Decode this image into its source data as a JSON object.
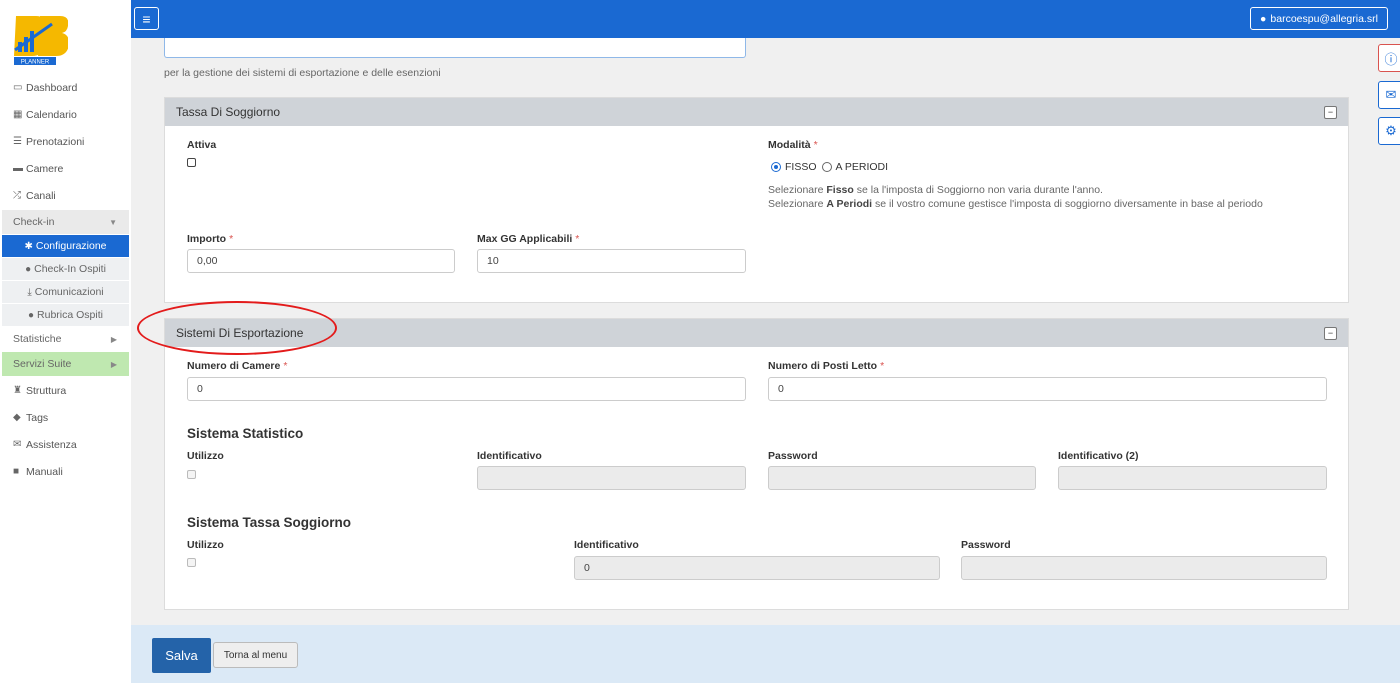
{
  "sidebar": {
    "logo_text": "PLANNER",
    "items": [
      {
        "icon": "desktop-icon",
        "label": "Dashboard"
      },
      {
        "icon": "calendar-icon",
        "label": "Calendario"
      },
      {
        "icon": "list-icon",
        "label": "Prenotazioni"
      },
      {
        "icon": "bed-icon",
        "label": "Camere"
      },
      {
        "icon": "random-icon",
        "label": "Canali"
      }
    ],
    "checkin_group": "Check-in",
    "checkin_sub": [
      {
        "icon": "gear-icon",
        "label": "Configurazione",
        "active": true
      },
      {
        "icon": "user-icon",
        "label": "Check-In Ospiti"
      },
      {
        "icon": "download-icon",
        "label": "Comunicazioni"
      },
      {
        "icon": "user-icon",
        "label": "Rubrica Ospiti"
      }
    ],
    "statistiche": "Statistiche",
    "servizi_suite": "Servizi Suite",
    "bottom_items": [
      {
        "icon": "building-icon",
        "label": "Struttura"
      },
      {
        "icon": "tags-icon",
        "label": "Tags"
      },
      {
        "icon": "envelope-icon",
        "label": "Assistenza"
      },
      {
        "icon": "book-icon",
        "label": "Manuali"
      }
    ]
  },
  "topbar": {
    "user": "barcoespu@allegria.srl"
  },
  "main": {
    "help_top": "per la gestione dei sistemi di esportazione e delle esenzioni",
    "tassa": {
      "title": "Tassa Di Soggiorno",
      "attiva_label": "Attiva",
      "modalita_label": "Modalità",
      "radio_fisso": "FISSO",
      "radio_periodi": "A PERIODI",
      "help_line1_pre": "Selezionare ",
      "help_line1_bold": "Fisso",
      "help_line1_post": " se la l'imposta di Soggiorno non varia durante l'anno.",
      "help_line2_pre": "Selezionare ",
      "help_line2_bold": "A Periodi",
      "help_line2_post": " se il vostro comune gestisce l'imposta di soggiorno diversamente in base al periodo",
      "importo_label": "Importo",
      "importo_value": "0,00",
      "maxgg_label": "Max GG Applicabili",
      "maxgg_value": "10"
    },
    "esportazione": {
      "title": "Sistemi Di Esportazione",
      "camere_label": "Numero di Camere",
      "camere_value": "0",
      "posti_label": "Numero di Posti Letto",
      "posti_value": "0",
      "statistico_title": "Sistema Statistico",
      "utilizzo_label": "Utilizzo",
      "identificativo_label": "Identificativo",
      "password_label": "Password",
      "identificativo2_label": "Identificativo (2)",
      "tassa_title": "Sistema Tassa Soggiorno",
      "utilizzo2_label": "Utilizzo",
      "identificativo3_label": "Identificativo",
      "identificativo3_value": "0",
      "password2_label": "Password"
    }
  },
  "footer": {
    "save_label": "Salva",
    "back_label": "Torna al menu"
  },
  "colors": {
    "accent": "#1a69d2",
    "save": "#2463a9",
    "annotation": "#e31b1b"
  }
}
